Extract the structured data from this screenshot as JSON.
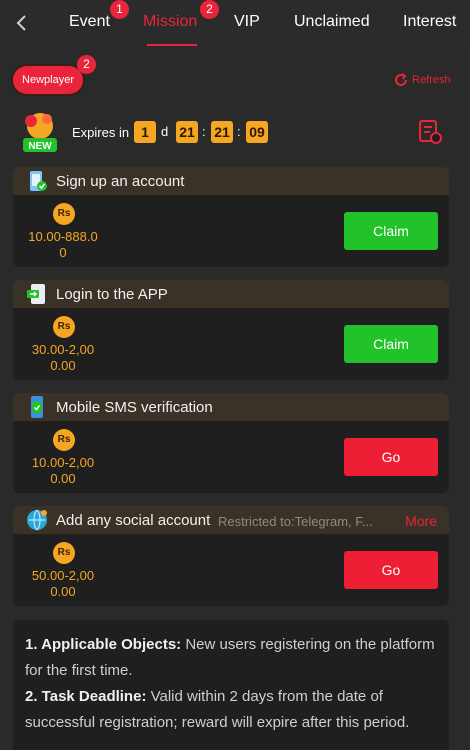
{
  "nav": {
    "tabs": [
      {
        "label": "Event",
        "badge": "1"
      },
      {
        "label": "Mission",
        "badge": "2"
      },
      {
        "label": "VIP"
      },
      {
        "label": "Unclaimed"
      },
      {
        "label": "Interest"
      }
    ],
    "active_tab": "Mission",
    "accent_color": "#e8253a"
  },
  "filter": {
    "label": "Newplayer",
    "badge": "2"
  },
  "refresh": {
    "label": "Refresh"
  },
  "expires": {
    "label": "Expires in",
    "days": "1",
    "days_unit": "d",
    "hours": "21",
    "minutes": "21",
    "seconds": "09",
    "icon_text": "NEW"
  },
  "tasks": [
    {
      "icon": "phone-check-icon",
      "title": "Sign up an account",
      "currency": "Rs",
      "amount_line1": "10.00-888.0",
      "amount_line2": "0",
      "action": "Claim"
    },
    {
      "icon": "app-login-icon",
      "title": "Login to the APP",
      "currency": "Rs",
      "amount_line1": "30.00-2,00",
      "amount_line2": "0.00",
      "action": "Claim"
    },
    {
      "icon": "sms-shield-icon",
      "title": "Mobile SMS verification",
      "currency": "Rs",
      "amount_line1": "10.00-2,00",
      "amount_line2": "0.00",
      "action": "Go"
    },
    {
      "icon": "social-globe-icon",
      "title": "Add any social account",
      "restriction": "Restricted to:Telegram, F...",
      "more": "More",
      "currency": "Rs",
      "amount_line1": "50.00-2,00",
      "amount_line2": "0.00",
      "action": "Go"
    }
  ],
  "rules": {
    "item1_title": "1. Applicable Objects:",
    "item1_text": "New users registering on the platform for the first time.",
    "item2_title": "2. Task Deadline:",
    "item2_text": "Valid within 2 days from the date of successful registration; reward will expire after this period."
  }
}
